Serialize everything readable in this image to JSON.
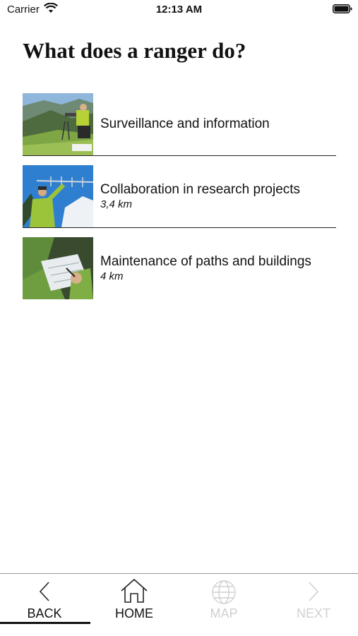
{
  "status": {
    "carrier": "Carrier",
    "time": "12:13 AM"
  },
  "title": "What does a ranger do?",
  "items": [
    {
      "title": "Surveillance and information",
      "distance": ""
    },
    {
      "title": "Collaboration in research projects",
      "distance": "3,4 km"
    },
    {
      "title": "Maintenance of paths and buildings",
      "distance": "4 km"
    }
  ],
  "tabs": [
    {
      "label": "BACK",
      "icon": "chevron-left-icon",
      "enabled": true,
      "active": true
    },
    {
      "label": "HOME",
      "icon": "home-icon",
      "enabled": true,
      "active": false
    },
    {
      "label": "MAP",
      "icon": "globe-icon",
      "enabled": false,
      "active": false
    },
    {
      "label": "NEXT",
      "icon": "chevron-right-icon",
      "enabled": false,
      "active": false
    }
  ]
}
